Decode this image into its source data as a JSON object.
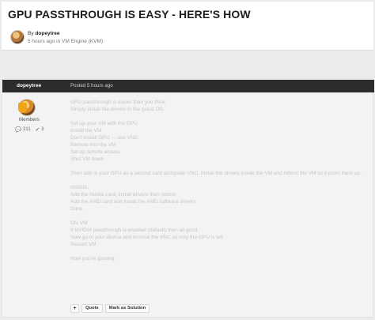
{
  "topic": {
    "title": "GPU PASSTHROUGH IS EASY - HERE'S HOW",
    "by_prefix": "By",
    "author": "dopeytree",
    "time_ago": "5 hours ago",
    "in_label": "in",
    "forum": "VM Engine (KVM)"
  },
  "post": {
    "author": "dopeytree",
    "posted": "Posted 5 hours ago",
    "group": "Members",
    "stats": {
      "posts": "211",
      "reputation": "3"
    },
    "paragraphs": [
      [
        "GPU passthrough is easier than you think",
        "Simply install the drivers to the guest OS."
      ],
      [
        "Set up your VM with the GPU",
        "Install the VM",
        "Don't install GPU — use VNC",
        "Remote into the VM",
        "Set up remote access",
        "Shut VM down"
      ],
      [
        "Then add in your GPU as a second card alongside VNC. Install the drivers inside the VM and reboot the VM so it picks them up."
      ],
      [
        "NVIDIA:",
        "Add the Nvidia card, install drivers then reboot",
        "Add the AMD card and install the AMD software drivers",
        "Done"
      ],
      [
        "Gfx VM",
        "If NVIDIA passthrough is enabled (default) then all good",
        "Now go to your device and remove the VNC so only the GPU is left",
        "Restart VM"
      ],
      [
        "Now you're gaming"
      ]
    ],
    "actions": {
      "plus": "+",
      "quote": "Quote",
      "mark_solution": "Mark as Solution"
    }
  },
  "colors": {
    "header_bg": "#2c2c2c",
    "page_bg": "#ebebeb",
    "post_bg": "#f3f3f3",
    "badge": "#f0a516"
  },
  "icons": {
    "posts": "comment-icon",
    "reputation": "reputation-icon"
  }
}
